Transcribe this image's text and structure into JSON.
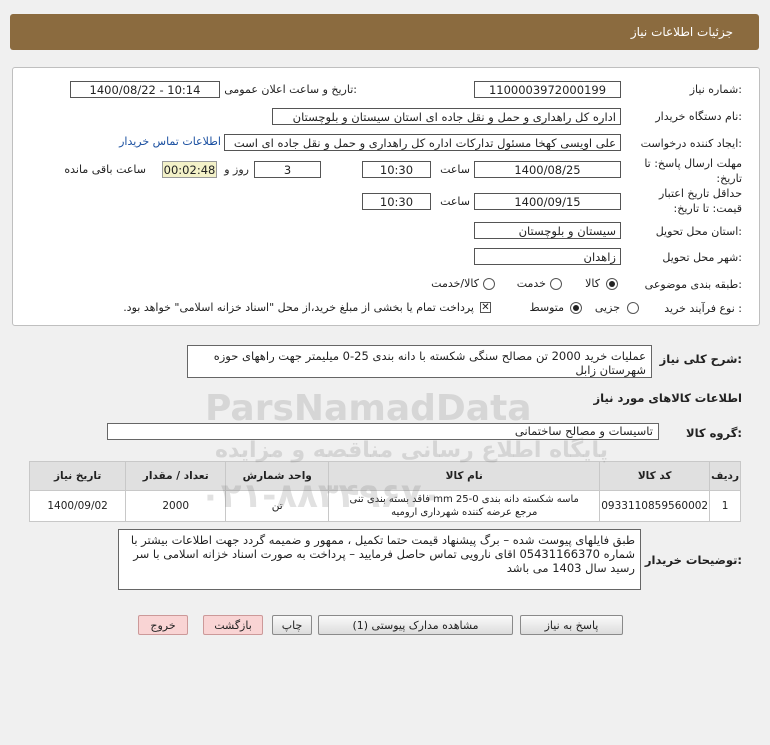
{
  "header": {
    "title": "جزئیات اطلاعات نیاز"
  },
  "fields": {
    "need_number_label": "شماره نیاز:",
    "need_number": "1100003972000199",
    "announce_label": "تاریخ و ساعت اعلان عمومی:",
    "announce_value": "1400/08/22 - 10:14",
    "buyer_org_label": "نام دستگاه خریدار:",
    "buyer_org": "اداره کل راهداری و حمل و نقل جاده ای استان سیستان و بلوچستان",
    "requester_label": "ایجاد کننده درخواست:",
    "requester": "علی اویسی کهخا مسئول تدارکات اداره کل راهداری و حمل و نقل جاده ای است",
    "contact_link": "اطلاعات تماس خریدار",
    "deadline_label": "مهلت ارسال پاسخ: تا تاریخ:",
    "deadline_date": "1400/08/25",
    "time_word": "ساعت",
    "deadline_time": "10:30",
    "days_value": "3",
    "days_word": "روز و",
    "remaining_time": "00:02:48",
    "remaining_label": "ساعت باقی مانده",
    "validity_label": "حداقل تاریخ اعتبار قیمت: تا تاریخ:",
    "validity_date": "1400/09/15",
    "validity_time": "10:30",
    "province_label": "استان محل تحویل:",
    "province": "سیستان و بلوچستان",
    "city_label": "شهر محل تحویل:",
    "city": "زاهدان",
    "category_label": "طبقه بندی موضوعی:",
    "category_options": [
      "کالا",
      "خدمت",
      "کالا/خدمت"
    ],
    "process_label": "نوع فرآیند خرید :",
    "process_options": [
      "جزیی",
      "متوسط"
    ],
    "payment_note": "پرداخت تمام یا بخشی از مبلغ خرید،از محل \"اسناد خزانه اسلامی\" خواهد بود."
  },
  "description": {
    "label": "شرح کلی نیاز:",
    "text": "عملیات خرید 2000 تن مصالح سنگی شکسته با دانه بندی 25-0 میلیمتر جهت راههای حوزه شهرستان زابل"
  },
  "goods": {
    "section_title": "اطلاعات کالاهای مورد نیاز",
    "group_label": "گروه کالا:",
    "group_value": "تاسیسات و مصالح ساختمانی",
    "columns": [
      "ردیف",
      "کد کالا",
      "نام کالا",
      "واحد شمارش",
      "تعداد / مقدار",
      "تاریخ نیاز"
    ],
    "rows": [
      {
        "row": "1",
        "code": "0933110859560002",
        "name_line1": "ماسه شکسته دانه بندی mm 25-0 فاقد بسته بندی تنی",
        "name_line2": "مرجع عرضه کننده شهرداری ارومیه",
        "unit": "تن",
        "qty": "2000",
        "date": "1400/09/02"
      }
    ]
  },
  "buyer_notes": {
    "label": "توضیحات خریدار:",
    "text": "طبق فایلهای پیوست شده – برگ پیشنهاد قیمت حتما تکمیل ، ممهور و ضمیمه گردد جهت اطلاعات بیشتر با شماره 05431166370 اقای نارویی تماس حاصل فرمایید – پرداخت به صورت اسناد خزانه اسلامی با سر رسید سال 1403 می باشد"
  },
  "buttons": {
    "reply": "پاسخ به نیاز",
    "attachments": "مشاهده مدارک پیوستی (1)",
    "print": "چاپ",
    "back": "بازگشت",
    "exit": "خروج"
  },
  "watermark": {
    "brand": "ParsNamadData",
    "tagline": "پایگاه اطلاع رسانی مناقصه و مزایده",
    "phone": "۰۲۱-۸۸۳۴۹۶۷۰"
  }
}
